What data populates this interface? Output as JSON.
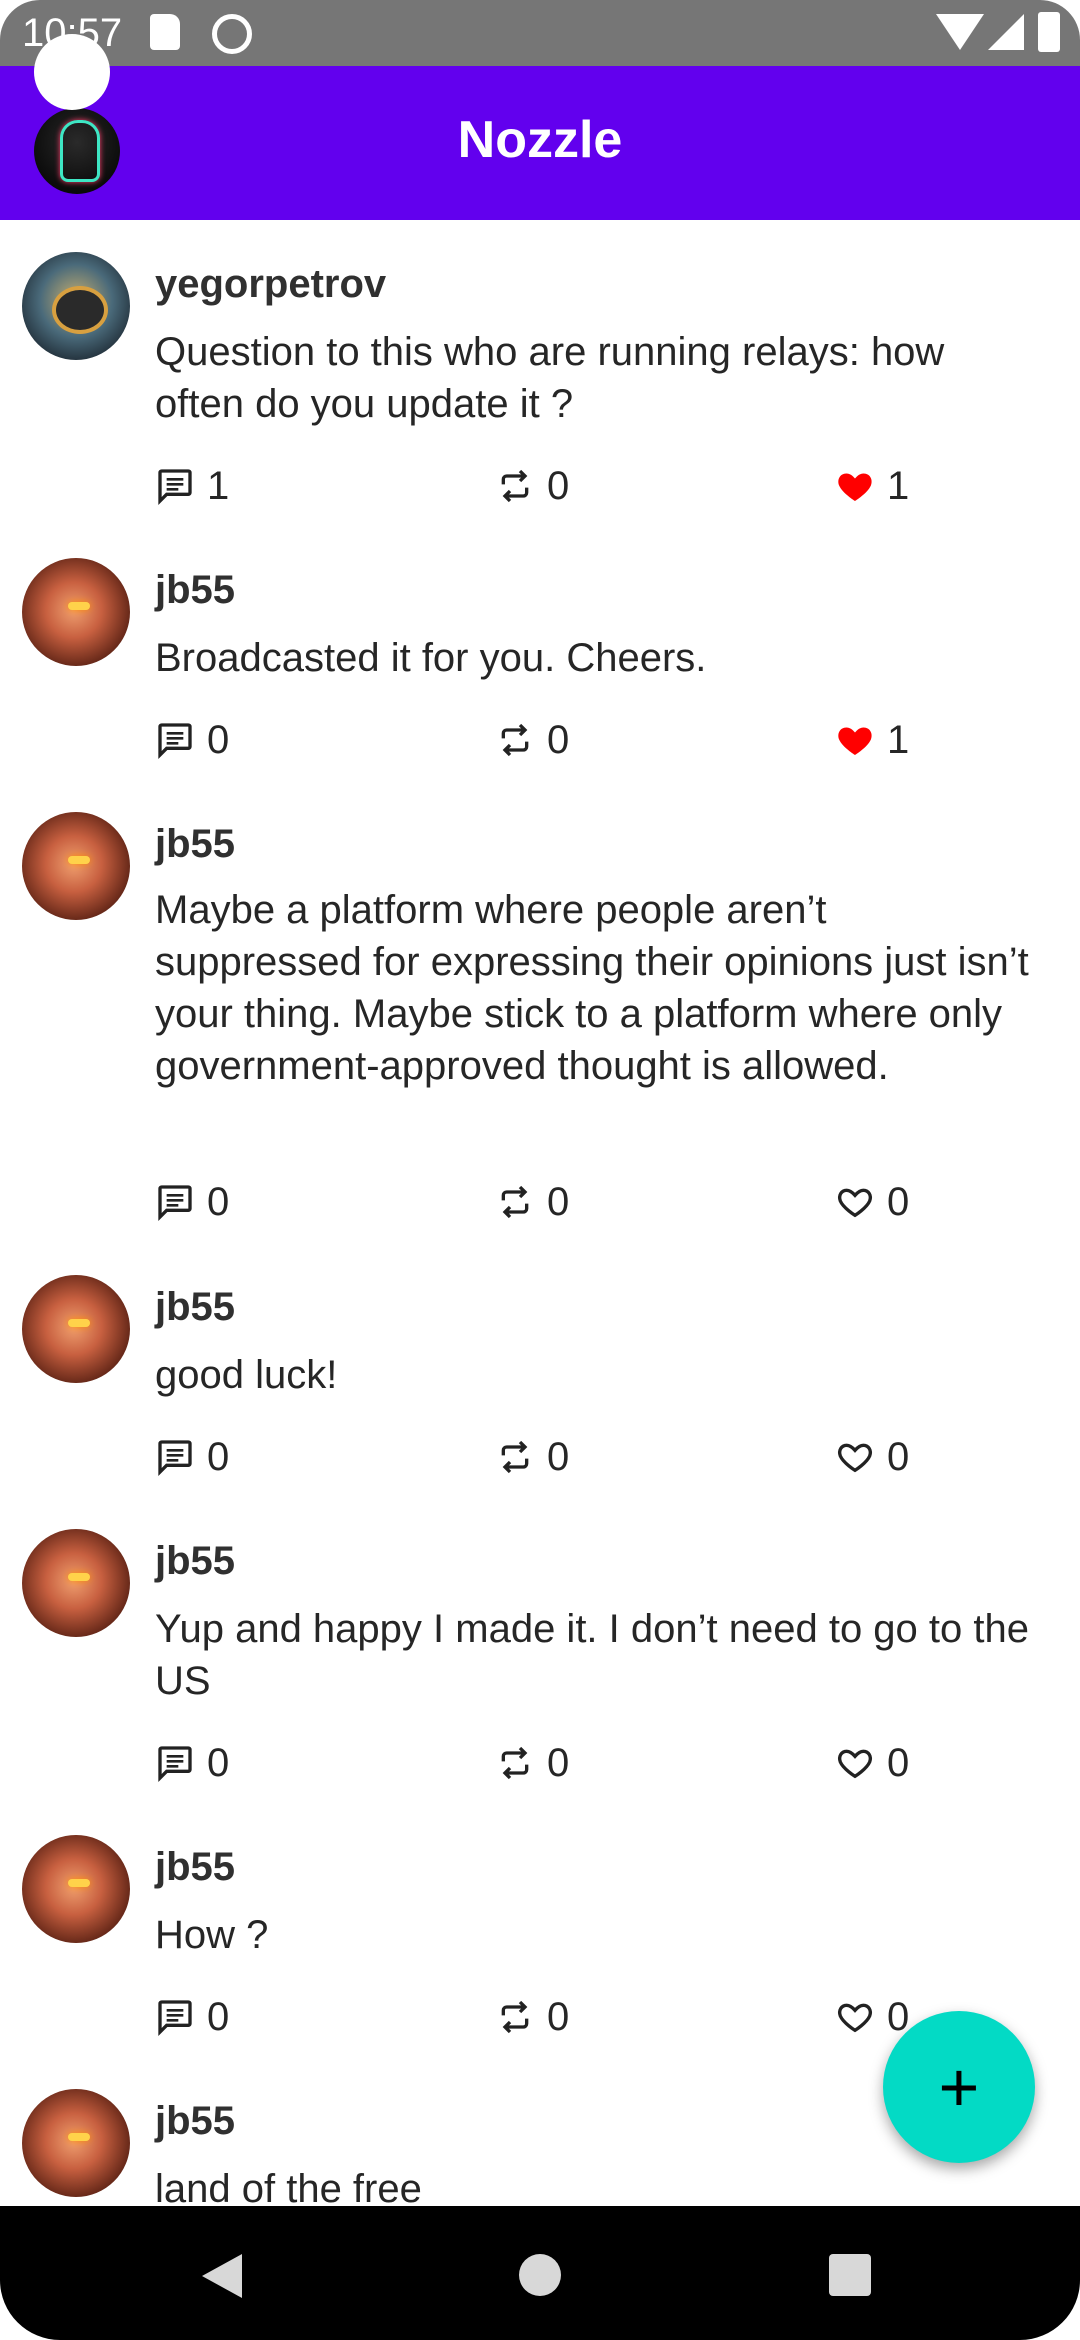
{
  "status_bar": {
    "time": "10:57"
  },
  "app_bar": {
    "title": "Nozzle",
    "accent": "#6200ee"
  },
  "colors": {
    "fab": "#03dac5",
    "like_active": "#ff0000"
  },
  "posts": [
    {
      "author": "yegorpetrov",
      "text": "Question to  this who are running relays: how often do you update it ?",
      "replies": "1",
      "boosts": "0",
      "likes": "1",
      "liked": true
    },
    {
      "author": "jb55",
      "text": "Broadcasted it for you. Cheers.",
      "replies": "0",
      "boosts": "0",
      "likes": "1",
      "liked": true
    },
    {
      "author": "jb55",
      "text": "Maybe a platform where people aren’t suppressed for expressing their opinions just isn’t your thing. Maybe stick to a platform where only government-approved thought is allowed.",
      "replies": "0",
      "boosts": "0",
      "likes": "0",
      "liked": false
    },
    {
      "author": "jb55",
      "text": "good luck!",
      "replies": "0",
      "boosts": "0",
      "likes": "0",
      "liked": false
    },
    {
      "author": "jb55",
      "text": "Yup and happy I made it. I don’t need to go to the US",
      "replies": "0",
      "boosts": "0",
      "likes": "0",
      "liked": false
    },
    {
      "author": "jb55",
      "text": "How ?",
      "replies": "0",
      "boosts": "0",
      "likes": "0",
      "liked": false
    },
    {
      "author": "jb55",
      "text": "land of the free",
      "replies": "",
      "boosts": "",
      "likes": "",
      "liked": false
    }
  ],
  "fab": {
    "label": "+"
  }
}
